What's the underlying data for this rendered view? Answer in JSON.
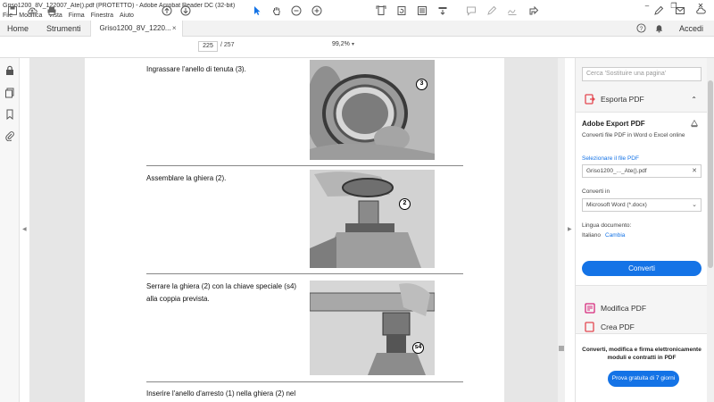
{
  "window": {
    "title": "Griso1200_8V_122007_Ate().pdf (PROTETTO) - Adobe Acrobat Reader DC (32-bit)",
    "controls": [
      "–",
      "❐",
      "✕"
    ]
  },
  "menu": [
    "File",
    "Modifica",
    "Vista",
    "Firma",
    "Finestra",
    "Aiuto"
  ],
  "tabs": {
    "home": "Home",
    "tools": "Strumenti",
    "document": "Griso1200_8V_1220...",
    "document_close": "×",
    "signin": "Accedi"
  },
  "toolbar": {
    "page_current": "225",
    "page_total": "/ 257",
    "zoom": "99,2%",
    "zoom_caret": "▾"
  },
  "document": {
    "steps": [
      {
        "text": "Ingrassare l'anello di tenuta (3).",
        "callout": "3"
      },
      {
        "text": "Assemblare la ghiera (2).",
        "callout": "2"
      },
      {
        "text": "Serrare la ghiera (2) con la chiave speciale (s4) alla coppia prevista.",
        "callout": "s4"
      },
      {
        "text": "Inserire l'anello d'arresto (1) nella ghiera (2) nel",
        "callout": ""
      }
    ]
  },
  "right_panel": {
    "search_placeholder": "Cerca 'Sostituire una pagina'",
    "export_section": "Esporta PDF",
    "export_chevron": "⌃",
    "export_title": "Adobe Export PDF",
    "export_desc": "Converti file PDF in Word o Excel online",
    "select_file_label": "Selezionare il file PDF",
    "selected_file": "Griso1200_..._Ate().pdf",
    "selected_file_clear": "✕",
    "convert_to_label": "Converti in",
    "convert_to_value": "Microsoft Word (*.docx)",
    "convert_to_caret": "⌄",
    "language_label": "Lingua documento:",
    "language_value": "Italiano",
    "language_change": "Cambia",
    "convert_button": "Converti",
    "edit_pdf": "Modifica PDF",
    "create_pdf": "Crea PDF",
    "promo_text": "Converti, modifica e firma elettronicamente moduli e contratti in PDF",
    "promo_button": "Prova gratuita di 7 giorni"
  },
  "colors": {
    "accent": "#1473e6",
    "export_icon": "#e34850",
    "edit_icon": "#d6297c",
    "create_icon": "#e34850"
  }
}
